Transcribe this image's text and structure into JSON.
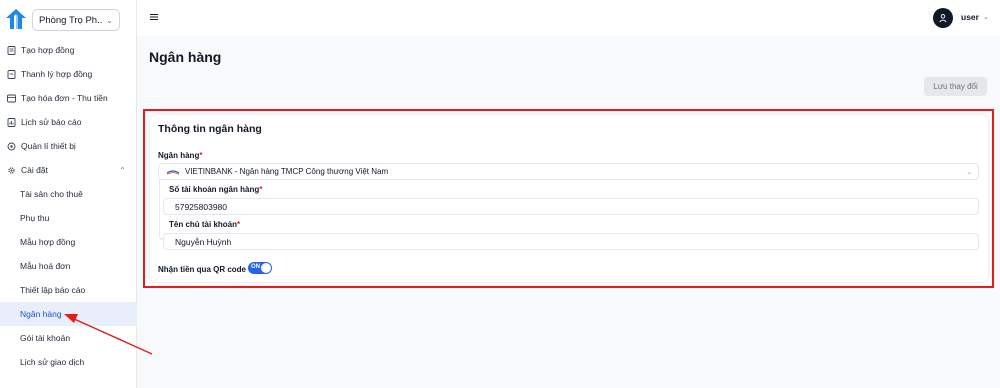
{
  "sidebar": {
    "property_select": "Phòng Trọ Ph...",
    "menu": [
      {
        "label": "Tạo hợp đồng",
        "icon": "contract-icon"
      },
      {
        "label": "Thanh lý hợp đồng",
        "icon": "contract-end-icon"
      },
      {
        "label": "Tạo hóa đơn - Thu tiền",
        "icon": "invoice-icon"
      },
      {
        "label": "Lịch sử báo cáo",
        "icon": "report-icon"
      },
      {
        "label": "Quản lí thiết bị",
        "icon": "device-icon"
      },
      {
        "label": "Cài đặt",
        "icon": "settings-icon"
      }
    ],
    "submenu": [
      {
        "label": "Tài sản cho thuê"
      },
      {
        "label": "Phụ thu"
      },
      {
        "label": "Mẫu hợp đồng"
      },
      {
        "label": "Mẫu hoá đơn"
      },
      {
        "label": "Thiết lập báo cáo"
      },
      {
        "label": "Ngân hàng",
        "active": true
      },
      {
        "label": "Gói tài khoản"
      },
      {
        "label": "Lịch sử giao dịch"
      }
    ]
  },
  "header": {
    "user_name": "user"
  },
  "main": {
    "page_title": "Ngân hàng",
    "save_label": "Lưu thay đổi",
    "card_title": "Thông tin ngân hàng",
    "bank": {
      "label": "Ngân hàng",
      "value": "VIETINBANK - Ngân hàng TMCP Công thương Việt Nam"
    },
    "account_number": {
      "label": "Số tài khoản ngân hàng",
      "value": "57925803980"
    },
    "account_holder": {
      "label": "Tên chủ tài khoản",
      "value": "Nguyễn Huỳnh"
    },
    "qr": {
      "label": "Nhận tiền qua QR code",
      "toggle_text": "ON",
      "enabled": true
    }
  },
  "colors": {
    "accent": "#2563eb",
    "highlight": "#e11d1d",
    "active_bg": "#e8effb"
  }
}
